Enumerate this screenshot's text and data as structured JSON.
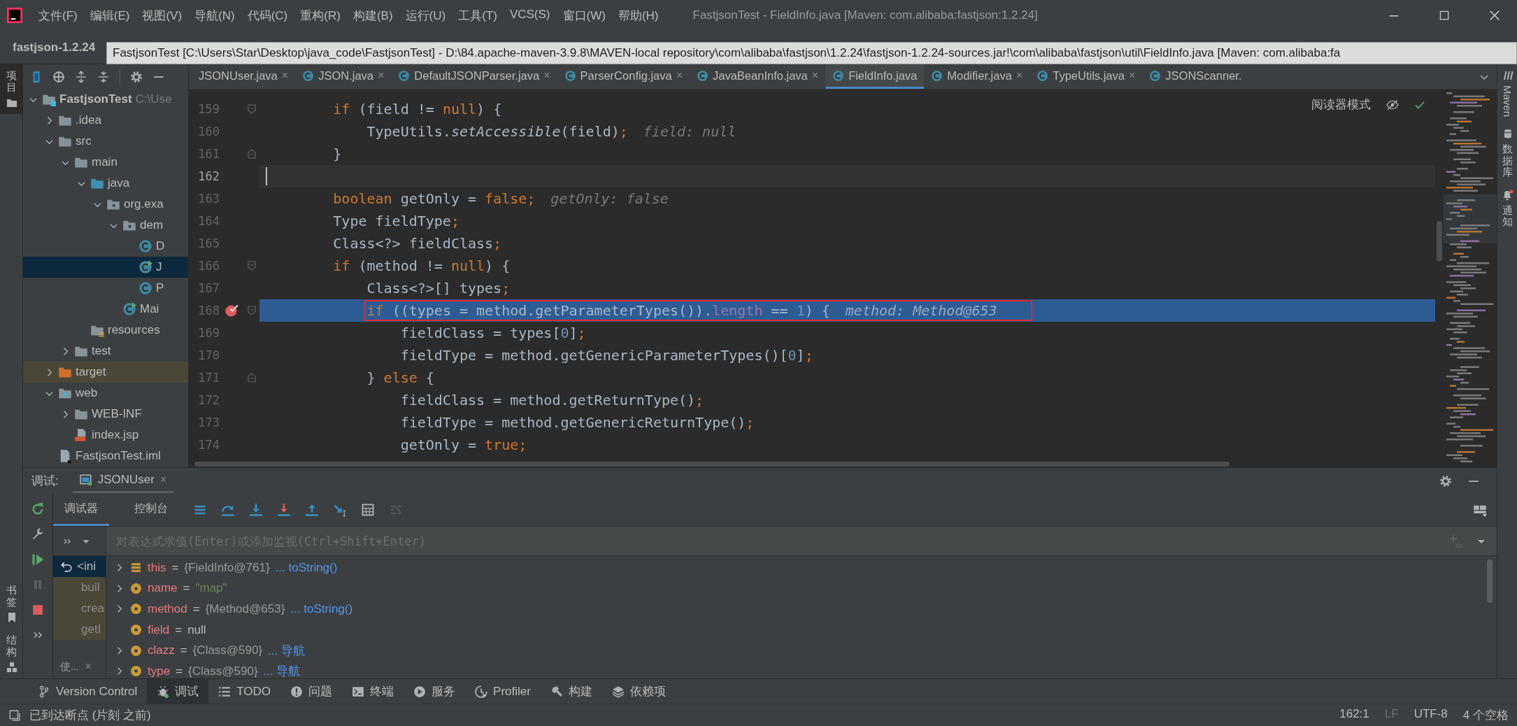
{
  "menu": [
    "文件(F)",
    "编辑(E)",
    "视图(V)",
    "导航(N)",
    "代码(C)",
    "重构(R)",
    "构建(B)",
    "运行(U)",
    "工具(T)",
    "VCS(S)",
    "窗口(W)",
    "帮助(H)"
  ],
  "window": {
    "title": "FastjsonTest - FieldInfo.java [Maven: com.alibaba:fastjson:1.2.24]"
  },
  "navigation": {
    "project": "fastjson-1.2.24"
  },
  "tooltip": "FastjsonTest [C:\\Users\\Star\\Desktop\\java_code\\FastjsonTest] - D:\\84.apache-maven-3.9.8\\MAVEN-local repository\\com\\alibaba\\fastjson\\1.2.24\\fastjson-1.2.24-sources.jar!\\com\\alibaba\\fastjson\\util\\FieldInfo.java [Maven: com.alibaba:fa",
  "left_strip": {
    "top": [
      {
        "label": "项目",
        "selected": true
      }
    ],
    "bottom": [
      {
        "label": "书签",
        "selected": false
      },
      {
        "label": "结构",
        "selected": false
      }
    ]
  },
  "right_strip": [
    {
      "label": "Maven",
      "kind": "latin"
    },
    {
      "label": "数据库",
      "kind": "cjk"
    },
    {
      "label": "通知",
      "kind": "cjk"
    }
  ],
  "project_tree": [
    {
      "label": "FastjsonTest",
      "note": "C:\\Use",
      "kind": "module",
      "expanded": true,
      "selected": false,
      "excluded": false,
      "children": [
        {
          "label": ".idea",
          "kind": "folder",
          "expanded": false,
          "selected": false,
          "excluded": false
        },
        {
          "label": "src",
          "kind": "folder",
          "expanded": true,
          "selected": false,
          "excluded": false,
          "children": [
            {
              "label": "main",
              "kind": "folder",
              "expanded": true,
              "selected": false,
              "excluded": false,
              "children": [
                {
                  "label": "java",
                  "kind": "source-folder",
                  "expanded": true,
                  "selected": false,
                  "excluded": false,
                  "children": [
                    {
                      "label": "org.exa",
                      "kind": "package",
                      "expanded": true,
                      "selected": false,
                      "excluded": false,
                      "children": [
                        {
                          "label": "dem",
                          "kind": "package",
                          "expanded": true,
                          "selected": false,
                          "excluded": false,
                          "children": [
                            {
                              "label": "D",
                              "kind": "class",
                              "selected": false,
                              "excluded": false
                            },
                            {
                              "label": "J",
                              "kind": "main-class",
                              "selected": true,
                              "excluded": false
                            },
                            {
                              "label": "P",
                              "kind": "class",
                              "selected": false,
                              "excluded": false
                            }
                          ]
                        },
                        {
                          "label": "Mai",
                          "kind": "main-class",
                          "selected": false,
                          "excluded": false
                        }
                      ]
                    }
                  ]
                },
                {
                  "label": "resources",
                  "kind": "resources-folder",
                  "selected": false,
                  "excluded": false
                }
              ]
            },
            {
              "label": "test",
              "kind": "folder",
              "expanded": false,
              "selected": false,
              "excluded": false
            }
          ]
        },
        {
          "label": "target",
          "kind": "excluded-folder",
          "expanded": false,
          "selected": false,
          "excluded": true
        },
        {
          "label": "web",
          "kind": "web-folder",
          "expanded": true,
          "selected": false,
          "excluded": false,
          "children": [
            {
              "label": "WEB-INF",
              "kind": "folder",
              "expanded": false,
              "selected": false,
              "excluded": false
            },
            {
              "label": "index.jsp",
              "kind": "jsp-file",
              "selected": false,
              "excluded": false
            }
          ]
        },
        {
          "label": "FastjsonTest.iml",
          "kind": "module-file",
          "selected": false,
          "excluded": false
        }
      ]
    }
  ],
  "editor_tabs": [
    {
      "label": "JSONUser.java",
      "close": "×",
      "selected": false
    },
    {
      "label": "JSON.java",
      "kind": "class",
      "close": "×",
      "selected": false
    },
    {
      "label": "DefaultJSONParser.java",
      "kind": "class",
      "close": "×",
      "selected": false
    },
    {
      "label": "ParserConfig.java",
      "kind": "class",
      "close": "×",
      "selected": false
    },
    {
      "label": "JavaBeanInfo.java",
      "kind": "class",
      "close": "×",
      "selected": false
    },
    {
      "label": "FieldInfo.java",
      "kind": "class",
      "selected": true
    },
    {
      "label": "Modifier.java",
      "kind": "class",
      "close": "×",
      "selected": false
    },
    {
      "label": "TypeUtils.java",
      "kind": "class",
      "close": "×",
      "selected": false
    },
    {
      "label": "JSONScanner.",
      "kind": "class",
      "selected": false
    }
  ],
  "reader_mode": "阅读器模式",
  "code_lines": [
    {
      "number": "159",
      "segments": [
        {
          "text": "        if",
          "kind": "keyword"
        },
        {
          "text": " (field != ",
          "kind": "plain"
        },
        {
          "text": "null",
          "kind": "keyword"
        },
        {
          "text": ") {",
          "kind": "plain"
        }
      ],
      "fold": {
        "kind": "open"
      },
      "current": false,
      "execution": false,
      "breakpoint": false,
      "boxed": false
    },
    {
      "number": "160",
      "segments": [
        {
          "text": "            TypeUtils.",
          "kind": "plain"
        },
        {
          "text": "setAccessible",
          "kind": "static"
        },
        {
          "text": "(field)",
          "kind": "plain"
        },
        {
          "text": ";",
          "kind": "keyword"
        }
      ],
      "hint": "field: null",
      "current": false,
      "execution": false,
      "breakpoint": false,
      "boxed": false
    },
    {
      "number": "161",
      "segments": [
        {
          "text": "        }",
          "kind": "plain"
        }
      ],
      "fold": {
        "kind": "close"
      },
      "current": false,
      "execution": false,
      "breakpoint": false,
      "boxed": false
    },
    {
      "number": "162",
      "current": true,
      "execution": false,
      "breakpoint": false,
      "boxed": false
    },
    {
      "number": "163",
      "segments": [
        {
          "text": "        boolean",
          "kind": "keyword"
        },
        {
          "text": " getOnly = ",
          "kind": "plain"
        },
        {
          "text": "false;",
          "kind": "keyword"
        }
      ],
      "hint": "getOnly: false",
      "current": false,
      "execution": false,
      "breakpoint": false,
      "boxed": false
    },
    {
      "number": "164",
      "segments": [
        {
          "text": "        Type fieldType",
          "kind": "plain"
        },
        {
          "text": ";",
          "kind": "keyword"
        }
      ],
      "current": false,
      "execution": false,
      "breakpoint": false,
      "boxed": false
    },
    {
      "number": "165",
      "segments": [
        {
          "text": "        Class<?> fieldClass",
          "kind": "plain"
        },
        {
          "text": ";",
          "kind": "keyword"
        }
      ],
      "current": false,
      "execution": false,
      "breakpoint": false,
      "boxed": false
    },
    {
      "number": "166",
      "segments": [
        {
          "text": "        if",
          "kind": "keyword"
        },
        {
          "text": " (method != ",
          "kind": "plain"
        },
        {
          "text": "null",
          "kind": "keyword"
        },
        {
          "text": ") {",
          "kind": "plain"
        }
      ],
      "fold": {
        "kind": "open"
      },
      "current": false,
      "execution": false,
      "breakpoint": false,
      "boxed": false
    },
    {
      "number": "167",
      "segments": [
        {
          "text": "            Class<?>[] types",
          "kind": "plain"
        },
        {
          "text": ";",
          "kind": "keyword"
        }
      ],
      "current": false,
      "execution": false,
      "breakpoint": false,
      "boxed": false
    },
    {
      "number": "168",
      "segments": [
        {
          "text": "            if",
          "kind": "keyword"
        },
        {
          "text": " ((types = method.getParameterTypes()).",
          "kind": "plain"
        },
        {
          "text": "length",
          "kind": "field"
        },
        {
          "text": " == ",
          "kind": "plain"
        },
        {
          "text": "1",
          "kind": "number"
        },
        {
          "text": ") {",
          "kind": "plain"
        }
      ],
      "hint": "method: Method@653",
      "fold": {
        "kind": "open"
      },
      "current": false,
      "execution": true,
      "breakpoint": true,
      "boxed": true
    },
    {
      "number": "169",
      "segments": [
        {
          "text": "                fieldClass = types[",
          "kind": "plain"
        },
        {
          "text": "0",
          "kind": "number"
        },
        {
          "text": "]",
          "kind": "plain"
        },
        {
          "text": ";",
          "kind": "keyword"
        }
      ],
      "current": false,
      "execution": false,
      "breakpoint": false,
      "boxed": false
    },
    {
      "number": "170",
      "segments": [
        {
          "text": "                fieldType = method.getGenericParameterTypes()[",
          "kind": "plain"
        },
        {
          "text": "0",
          "kind": "number"
        },
        {
          "text": "]",
          "kind": "plain"
        },
        {
          "text": ";",
          "kind": "keyword"
        }
      ],
      "current": false,
      "execution": false,
      "breakpoint": false,
      "boxed": false
    },
    {
      "number": "171",
      "segments": [
        {
          "text": "            } ",
          "kind": "plain"
        },
        {
          "text": "else",
          "kind": "keyword"
        },
        {
          "text": " {",
          "kind": "plain"
        }
      ],
      "fold": {
        "kind": "close"
      },
      "current": false,
      "execution": false,
      "breakpoint": false,
      "boxed": false
    },
    {
      "number": "172",
      "segments": [
        {
          "text": "                fieldClass = method.getReturnType()",
          "kind": "plain"
        },
        {
          "text": ";",
          "kind": "keyword"
        }
      ],
      "current": false,
      "execution": false,
      "breakpoint": false,
      "boxed": false
    },
    {
      "number": "173",
      "segments": [
        {
          "text": "                fieldType = method.getGenericReturnType()",
          "kind": "plain"
        },
        {
          "text": ";",
          "kind": "keyword"
        }
      ],
      "current": false,
      "execution": false,
      "breakpoint": false,
      "boxed": false
    },
    {
      "number": "174",
      "segments": [
        {
          "text": "                getOnly = ",
          "kind": "plain"
        },
        {
          "text": "true;",
          "kind": "keyword"
        }
      ],
      "current": false,
      "execution": false,
      "breakpoint": false,
      "boxed": false
    }
  ],
  "debug": {
    "label": "调试:",
    "session_tab": {
      "label": "JSONUser",
      "close": "×"
    },
    "subtabs": [
      {
        "label": "调试器",
        "selected": true
      },
      {
        "label": "控制台",
        "selected": false
      }
    ],
    "evaluate": {
      "placeholder": "对表达式求值(Enter)或添加监视(Ctrl+Shift+Enter)"
    },
    "frames": [
      {
        "label": "<ini",
        "selected": true
      },
      {
        "label": "buil",
        "selected": false
      },
      {
        "label": "crea",
        "selected": false
      },
      {
        "label": "getI",
        "selected": false
      }
    ],
    "frames_tab": {
      "label": "使...",
      "close": "×"
    },
    "variables": [
      {
        "name": "this",
        "equals": "=",
        "value": {
          "text": "{FieldInfo@761}",
          "kind": "object"
        },
        "link": "... toString()",
        "kind": "object",
        "expandable": true
      },
      {
        "name": "name",
        "equals": "=",
        "value": {
          "text": "\"map\"",
          "kind": "string"
        },
        "kind": "field",
        "expandable": true
      },
      {
        "name": "method",
        "equals": "=",
        "value": {
          "text": "{Method@653}",
          "kind": "object"
        },
        "link": "... toString()",
        "kind": "field",
        "expandable": true
      },
      {
        "name": "field",
        "equals": "=",
        "value": {
          "text": "null",
          "kind": "null"
        },
        "kind": "field",
        "expandable": false
      },
      {
        "name": "clazz",
        "equals": "=",
        "value": {
          "text": "{Class@590}",
          "kind": "object"
        },
        "link": "... 导航",
        "kind": "field",
        "expandable": true
      },
      {
        "name": "type",
        "equals": "=",
        "value": {
          "text": "{Class@590}",
          "kind": "object"
        },
        "link": "... 导航",
        "kind": "field",
        "expandable": true
      }
    ]
  },
  "tool_windows": [
    {
      "label": "Version Control",
      "selected": false
    },
    {
      "label": "调试",
      "selected": true
    },
    {
      "label": "TODO",
      "selected": false
    },
    {
      "label": "问题",
      "selected": false
    },
    {
      "label": "终端",
      "selected": false
    },
    {
      "label": "服务",
      "selected": false
    },
    {
      "label": "Profiler",
      "selected": false
    },
    {
      "label": "构建",
      "selected": false
    },
    {
      "label": "依赖项",
      "selected": false
    }
  ],
  "status_bar": {
    "message": "已到达断点 (片刻 之前)",
    "items": [
      {
        "text": "162:1",
        "dimmed": false
      },
      {
        "text": "LF",
        "dimmed": true
      },
      {
        "text": "UTF-8",
        "dimmed": false
      },
      {
        "text": "4 个空格",
        "dimmed": false
      }
    ]
  }
}
